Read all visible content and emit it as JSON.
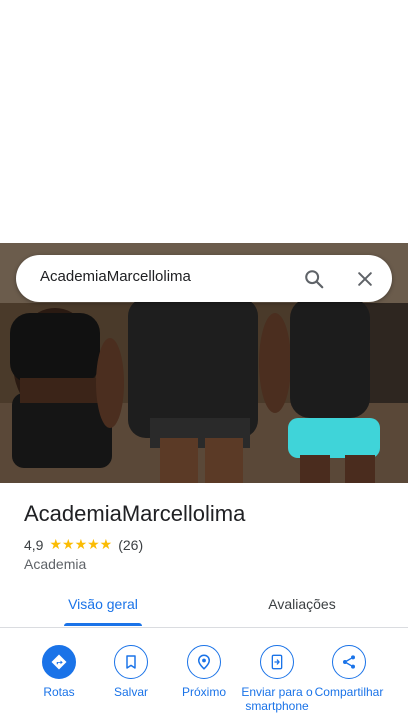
{
  "search": {
    "query": "AcademiaMarcellolima"
  },
  "place": {
    "name": "AcademiaMarcellolima",
    "rating": "4,9",
    "stars": "★★★★★",
    "reviews": "(26)",
    "category": "Academia"
  },
  "tabs": [
    {
      "label": "Visão geral"
    },
    {
      "label": "Avaliações"
    }
  ],
  "actions": [
    {
      "label": "Rotas",
      "icon": "directions-icon"
    },
    {
      "label": "Salvar",
      "icon": "bookmark-icon"
    },
    {
      "label": "Próximo",
      "icon": "nearby-icon"
    },
    {
      "label": "Enviar para o smartphone",
      "icon": "send-to-phone-icon"
    },
    {
      "label": "Compartilhar",
      "icon": "share-icon"
    }
  ],
  "colors": {
    "accent": "#1a73e8",
    "star": "#fbbc04"
  }
}
